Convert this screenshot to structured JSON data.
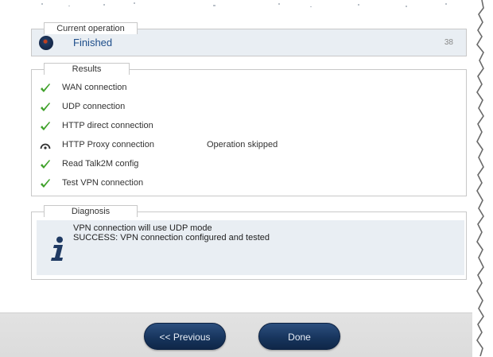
{
  "current_operation": {
    "title": "Current operation",
    "status": "Finished",
    "count": "38"
  },
  "results": {
    "title": "Results",
    "items": [
      {
        "label": "WAN connection",
        "status": "",
        "icon": "check-icon"
      },
      {
        "label": "UDP connection",
        "status": "",
        "icon": "check-icon"
      },
      {
        "label": "HTTP direct connection",
        "status": "",
        "icon": "check-icon"
      },
      {
        "label": "HTTP Proxy connection",
        "status": "Operation skipped",
        "icon": "skipped-gauge-icon"
      },
      {
        "label": "Read Talk2M config",
        "status": "",
        "icon": "check-icon"
      },
      {
        "label": "Test VPN connection",
        "status": "",
        "icon": "check-icon"
      }
    ]
  },
  "diagnosis": {
    "title": "Diagnosis",
    "lines": [
      "VPN connection will use UDP mode",
      "SUCCESS: VPN connection configured and tested"
    ]
  },
  "footer": {
    "previous_label": "<< Previous",
    "done_label": "Done"
  },
  "colors": {
    "accent": "#1d4d8a",
    "check": "#3fa12a",
    "button": "#1a365f",
    "panel_tint": "#e9eef3"
  }
}
